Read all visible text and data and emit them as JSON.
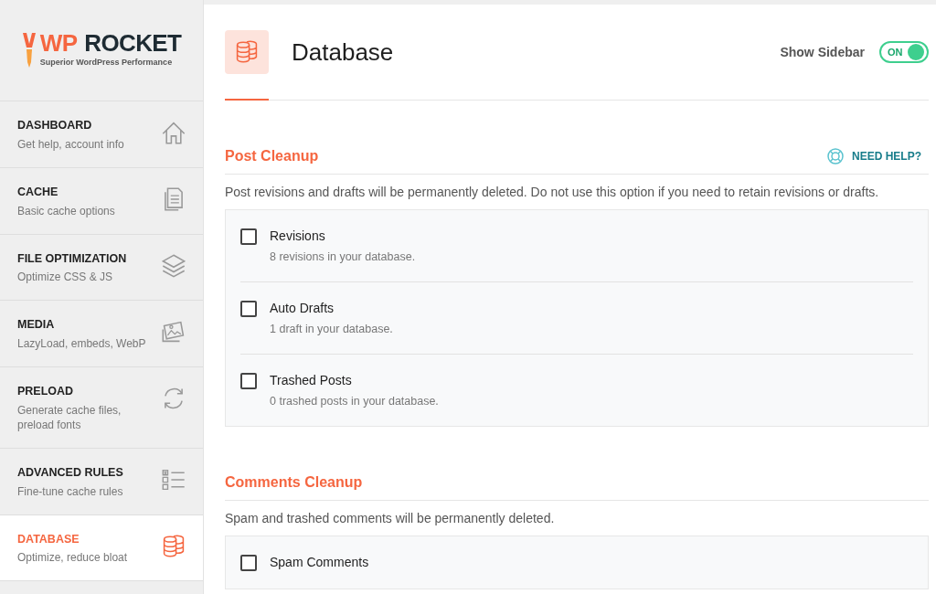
{
  "logo": {
    "mark": "WP",
    "word": "ROCKET",
    "tagline": "Superior WordPress Performance"
  },
  "sidebar": {
    "items": [
      {
        "title": "DASHBOARD",
        "subtitle": "Get help, account info",
        "kind": "home",
        "selected": false
      },
      {
        "title": "CACHE",
        "subtitle": "Basic cache options",
        "kind": "document",
        "selected": false
      },
      {
        "title": "FILE OPTIMIZATION",
        "subtitle": "Optimize CSS & JS",
        "kind": "layers",
        "selected": false
      },
      {
        "title": "MEDIA",
        "subtitle": "LazyLoad, embeds, WebP",
        "kind": "images",
        "selected": false
      },
      {
        "title": "PRELOAD",
        "subtitle": "Generate cache files, preload fonts",
        "kind": "refresh",
        "selected": false
      },
      {
        "title": "ADVANCED RULES",
        "subtitle": "Fine-tune cache rules",
        "kind": "checklist",
        "selected": false
      },
      {
        "title": "DATABASE",
        "subtitle": "Optimize, reduce bloat",
        "kind": "database",
        "selected": true
      }
    ]
  },
  "header": {
    "title": "Database",
    "toggle": {
      "label": "Show Sidebar",
      "state_text": "ON",
      "on": true
    }
  },
  "sections": [
    {
      "title": "Post Cleanup",
      "help": "NEED HELP?",
      "description": "Post revisions and drafts will be permanently deleted. Do not use this option if you need to retain revisions or drafts.",
      "options": [
        {
          "label": "Revisions",
          "note": "8 revisions in your database.",
          "checked": false
        },
        {
          "label": "Auto Drafts",
          "note": "1 draft in your database.",
          "checked": false
        },
        {
          "label": "Trashed Posts",
          "note": "0 trashed posts in your database.",
          "checked": false
        }
      ]
    },
    {
      "title": "Comments Cleanup",
      "description": "Spam and trashed comments will be permanently deleted.",
      "options": [
        {
          "label": "Spam Comments",
          "checked": false
        }
      ]
    }
  ]
}
